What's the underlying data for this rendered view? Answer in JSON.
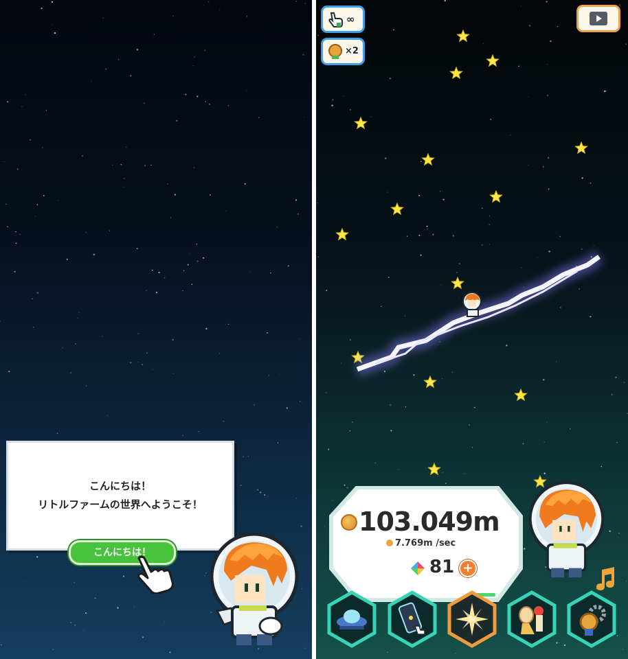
{
  "left_panel": {
    "dialog": {
      "line1": "こんにちは！",
      "line2": "リトルファームの世界へようこそ！"
    },
    "reply_button_label": "こんにちは！",
    "tutorial_hand_icon": "pointing-hand-icon",
    "character": "astronaut-character"
  },
  "right_panel": {
    "top_left": {
      "tap_boost": {
        "icon": "hand-tap-icon",
        "value": "∞"
      },
      "medal_count": {
        "icon": "medal-icon",
        "value": "×2"
      }
    },
    "top_right": {
      "icon": "video-play-icon"
    },
    "status": {
      "distance": "103.049m",
      "rate": "7.769m /sec",
      "gems": "81",
      "plus_label": "+"
    },
    "nav": [
      {
        "name": "ufo-nav-icon"
      },
      {
        "name": "phone-nav-icon"
      },
      {
        "name": "shine-nav-icon"
      },
      {
        "name": "food-nav-icon"
      },
      {
        "name": "settings-nav-icon"
      }
    ],
    "music_icon": "music-note-icon"
  },
  "colors": {
    "accent_green": "#49c23e",
    "hex_border_teal": "#35d0b5",
    "selected_orange": "#f09a3e",
    "star_yellow": "#ffe94a"
  }
}
